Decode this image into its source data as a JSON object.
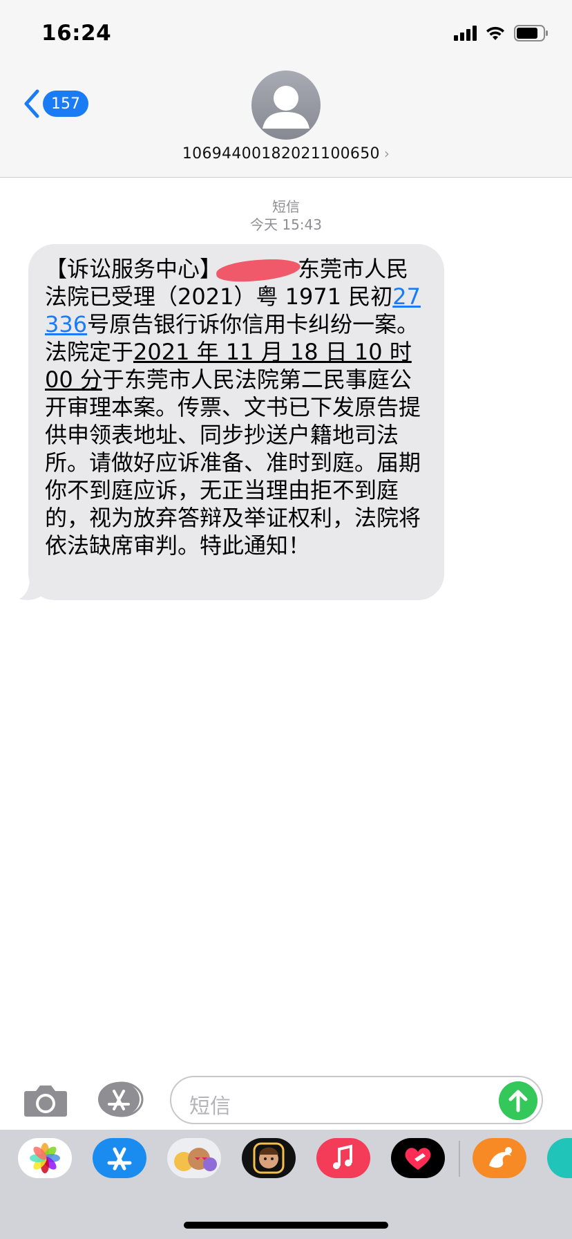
{
  "status_bar": {
    "time": "16:24"
  },
  "nav": {
    "back_count": "157",
    "contact": "10694400182021100650"
  },
  "message_meta": {
    "service": "短信",
    "timestamp": "今天 15:43"
  },
  "message": {
    "part1": "【诉讼服务中心】",
    "part2": "东莞市人民法院已受理（2021）粤 1971 民初",
    "link": "27336",
    "part3": "号原告银行诉你信用卡纠纷一案。法院定于",
    "datetime": "2021 年 11 月 18 日 10 时 00 分",
    "part4": "于东莞市人民法院第二民事庭公开审理本案。传票、文书已下发原告提供申领表地址、同步抄送户籍地司法所。请做好应诉准备、准时到庭。届期你不到庭应诉，无正当理由拒不到庭的，视为放弃答辩及举证权利，法院将依法缺席审判。特此通知！"
  },
  "input": {
    "placeholder": "短信"
  },
  "colors": {
    "accent": "#1a7cf5",
    "bubble": "#e9e9eb",
    "send": "#34c759",
    "redaction": "#f0596a"
  }
}
